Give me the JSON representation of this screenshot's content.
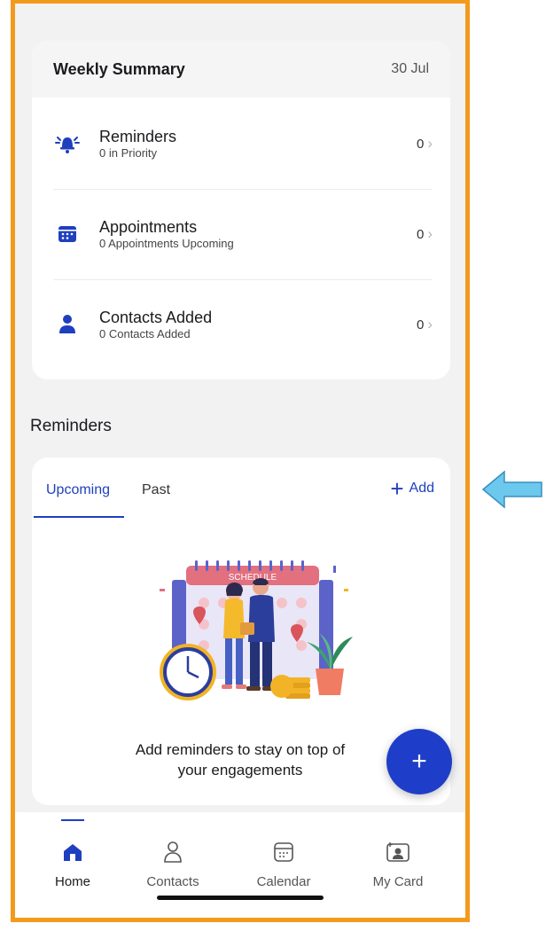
{
  "summary": {
    "title": "Weekly Summary",
    "date": "30 Jul",
    "rows": [
      {
        "icon": "bell-icon",
        "title": "Reminders",
        "subtitle": "0 in Priority",
        "count": "0"
      },
      {
        "icon": "calendar-icon",
        "title": "Appointments",
        "subtitle": "0 Appointments Upcoming",
        "count": "0"
      },
      {
        "icon": "person-icon",
        "title": "Contacts Added",
        "subtitle": "0 Contacts Added",
        "count": "0"
      }
    ]
  },
  "reminders": {
    "section_title": "Reminders",
    "tabs": [
      {
        "label": "Upcoming",
        "active": true
      },
      {
        "label": "Past",
        "active": false
      }
    ],
    "add_label": "Add",
    "empty_message": "Add reminders to stay on top of your engagements",
    "illustration_text": "SCHEDULE"
  },
  "nav": {
    "items": [
      {
        "label": "Home",
        "icon": "home-icon",
        "active": true
      },
      {
        "label": "Contacts",
        "icon": "contacts-icon",
        "active": false
      },
      {
        "label": "Calendar",
        "icon": "calendar-icon",
        "active": false
      },
      {
        "label": "My Card",
        "icon": "card-icon",
        "active": false
      }
    ]
  },
  "colors": {
    "accent": "#1f3fbf",
    "frame": "#f39a1e",
    "arrow": "#6cc8ec"
  }
}
